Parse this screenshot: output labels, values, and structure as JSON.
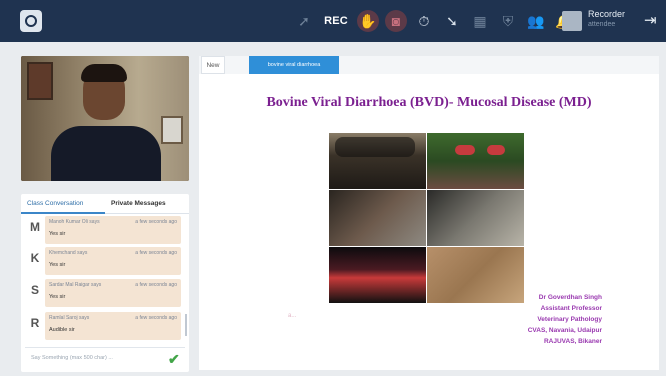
{
  "toolbar": {
    "rec_label": "REC",
    "icons": [
      "arrow-icon",
      "record-icon",
      "hand-icon",
      "camera-off-icon",
      "timer-icon",
      "pointer-icon",
      "grid-icon",
      "shield-icon",
      "users-icon",
      "bell-icon"
    ]
  },
  "user": {
    "name": "Recorder",
    "role": "attendee"
  },
  "chat": {
    "tabs": [
      "Class Conversation",
      "Private Messages"
    ],
    "messages": [
      {
        "initial": "M",
        "name": "Manoh Kumar Oli says",
        "time": "a few seconds ago",
        "text": "Yes sir"
      },
      {
        "initial": "K",
        "name": "Khemchand says",
        "time": "a few seconds ago",
        "text": "Yes sir"
      },
      {
        "initial": "S",
        "name": "Sardar Mal Raigar says",
        "time": "a few seconds ago",
        "text": "Yes sir"
      },
      {
        "initial": "R",
        "name": "Ramlal Saroj says",
        "time": "a few seconds ago",
        "text": "Audible sir"
      }
    ],
    "input_placeholder": "Say Something (max 500 char) ..."
  },
  "presentation": {
    "tabs": [
      "New",
      "bovine viral diarrhoea"
    ],
    "slide_title": "Bovine Viral Diarrhoea (BVD)- Mucosal Disease (MD)",
    "credit": [
      "Dr Goverdhan Singh",
      "Assistant Professor",
      "Veterinary Pathology",
      "CVAS, Navania, Udaipur",
      "RAJUVAS, Bikaner"
    ],
    "pointer_mark": "a..."
  },
  "colors": {
    "topbar": "#1f3350",
    "accent": "#2f8fd8",
    "title": "#7b2090",
    "credit": "#9a3ab0",
    "send": "#42a548"
  }
}
